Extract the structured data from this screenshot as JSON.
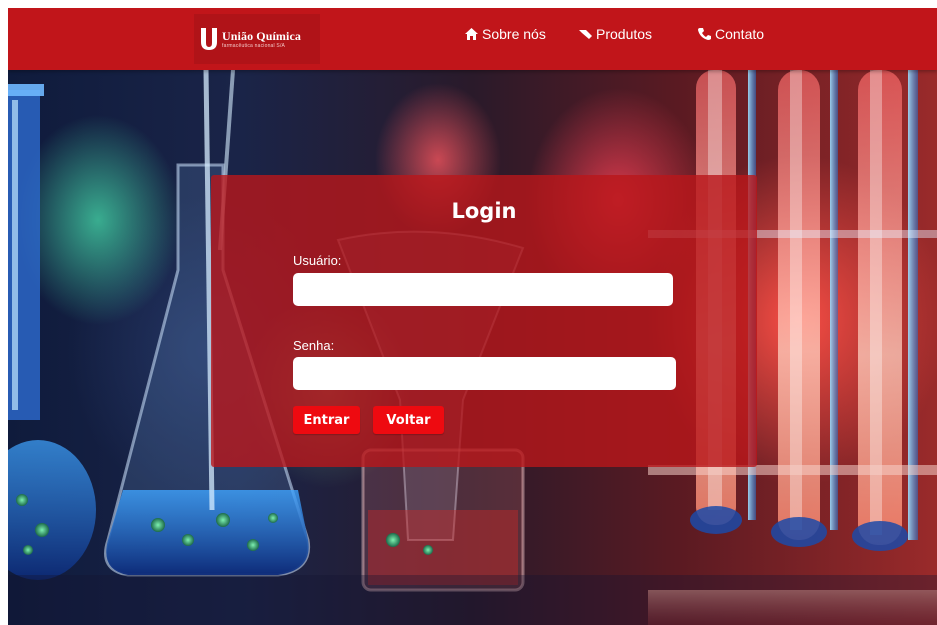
{
  "brand": {
    "name": "União Química",
    "tagline": "farmacêutica nacional S/A",
    "color": "#c1151a"
  },
  "nav": {
    "items": [
      {
        "label": "Sobre nós",
        "icon": "home-icon"
      },
      {
        "label": "Produtos",
        "icon": "tag-icon"
      },
      {
        "label": "Contato",
        "icon": "phone-icon"
      }
    ]
  },
  "login": {
    "title": "Login",
    "username_label": "Usuário:",
    "username_value": "",
    "password_label": "Senha:",
    "password_value": "",
    "submit_label": "Entrar",
    "back_label": "Voltar",
    "button_color": "#ee0a10"
  }
}
